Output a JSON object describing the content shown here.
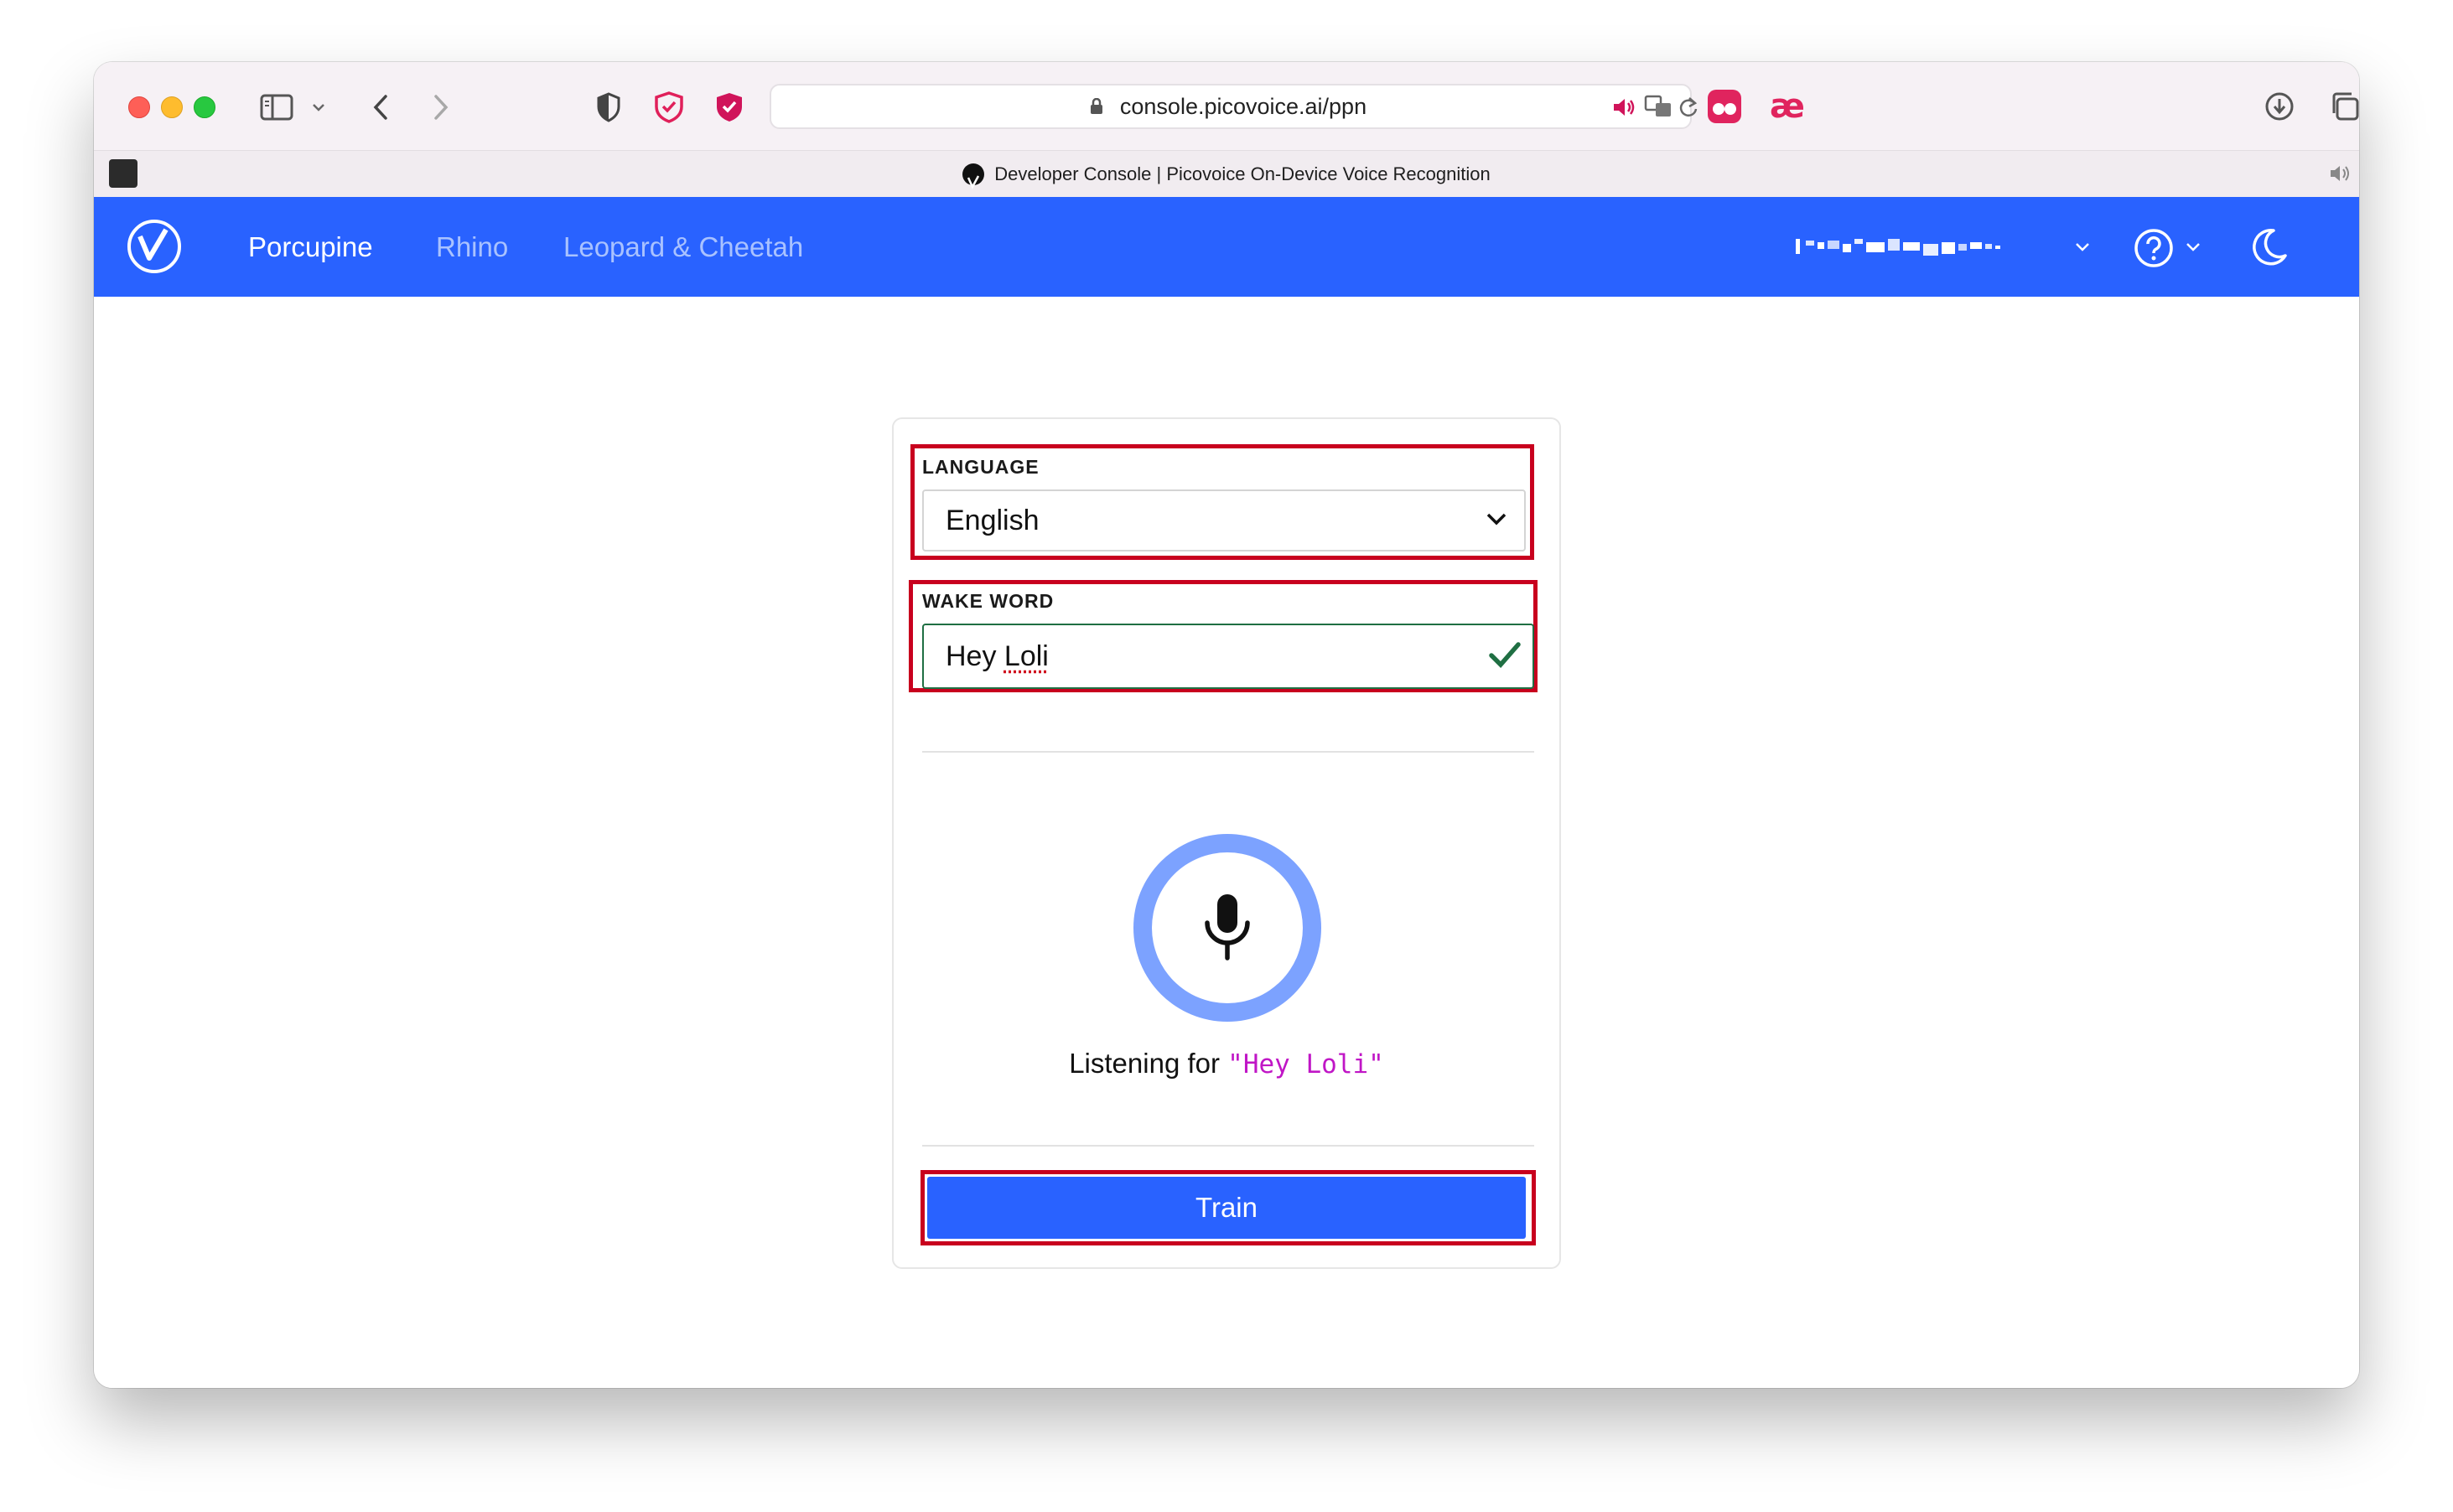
{
  "browser": {
    "url": "console.picovoice.ai/ppn",
    "tab_title": "Developer Console | Picovoice On-Device Voice Recognition"
  },
  "nav": {
    "items": [
      {
        "label": "Porcupine",
        "active": true
      },
      {
        "label": "Rhino",
        "active": false
      },
      {
        "label": "Leopard & Cheetah",
        "active": false
      }
    ]
  },
  "form": {
    "language_label": "LANGUAGE",
    "language_value": "English",
    "wake_word_label": "WAKE WORD",
    "wake_word_prefix": "Hey ",
    "wake_word_suffix": "Loli",
    "listening_text": "Listening for",
    "listening_keyword": "\"Hey Loli\"",
    "train_label": "Train"
  },
  "colors": {
    "brand_blue": "#2962ff",
    "highlight_red": "#c8001e",
    "mic_ring": "#7ca2ff",
    "keyword_magenta": "#c016c6",
    "valid_green": "#1f6f43"
  }
}
